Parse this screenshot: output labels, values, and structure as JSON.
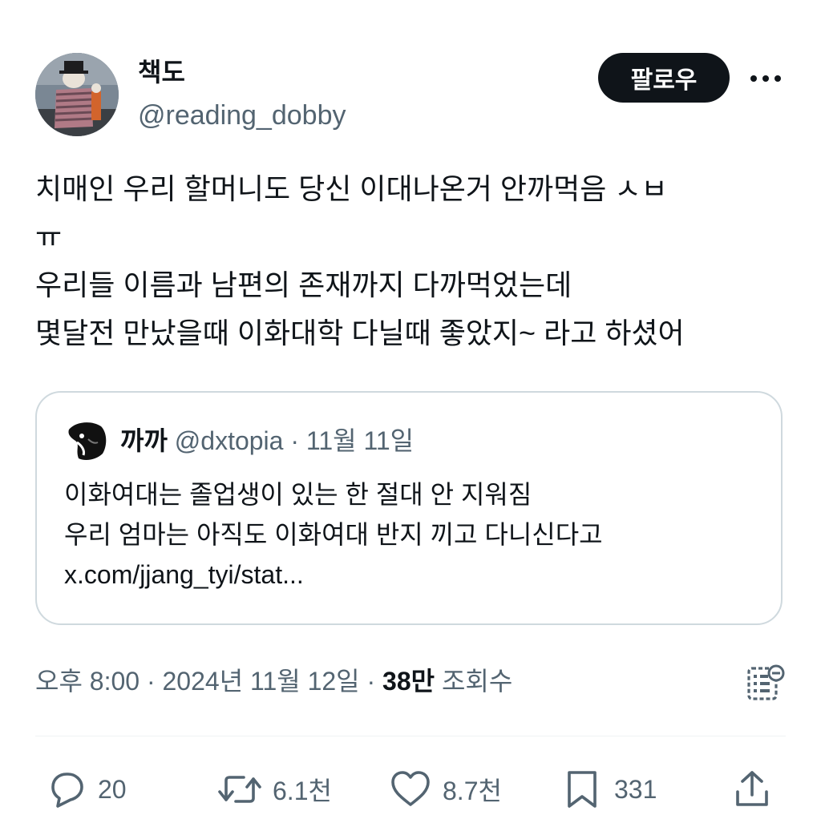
{
  "author": {
    "display_name": "책도",
    "handle": "@reading_dobby"
  },
  "follow_label": "팔로우",
  "tweet": {
    "lines": [
      "치매인 우리 할머니도 당신 이대나온거 안까먹음 ㅅㅂ",
      "ㅠ",
      "우리들 이름과 남편의 존재까지 다까먹었는데",
      "몇달전 만났을때 이화대학 다닐때 좋았지~ 라고 하셨어"
    ]
  },
  "quote": {
    "display_name": "까까",
    "handle": "@dxtopia",
    "separator": "·",
    "date": "11월 11일",
    "lines": [
      "이화여대는 졸업생이 있는 한 절대 안 지워짐",
      "우리 엄마는 아직도 이화여대 반지 끼고 다니신다고",
      "x.com/jjang_tyi/stat..."
    ]
  },
  "meta": {
    "time": "오후 8:00",
    "date": "2024년 11월 12일",
    "separator": "·",
    "views_count": "38만",
    "views_label": "조회수"
  },
  "actions": {
    "replies": "20",
    "reposts": "6.1천",
    "likes": "8.7천",
    "bookmarks": "331"
  },
  "icons": {
    "more": "more-horizontal-icon",
    "analytics": "view-analytics-icon",
    "reply": "reply-icon",
    "repost": "repost-icon",
    "like": "heart-icon",
    "bookmark": "bookmark-icon",
    "share": "share-icon"
  },
  "colors": {
    "text_primary": "#0f1419",
    "text_secondary": "#536471",
    "border": "#cfd9de",
    "follow_bg": "#0f1419"
  }
}
